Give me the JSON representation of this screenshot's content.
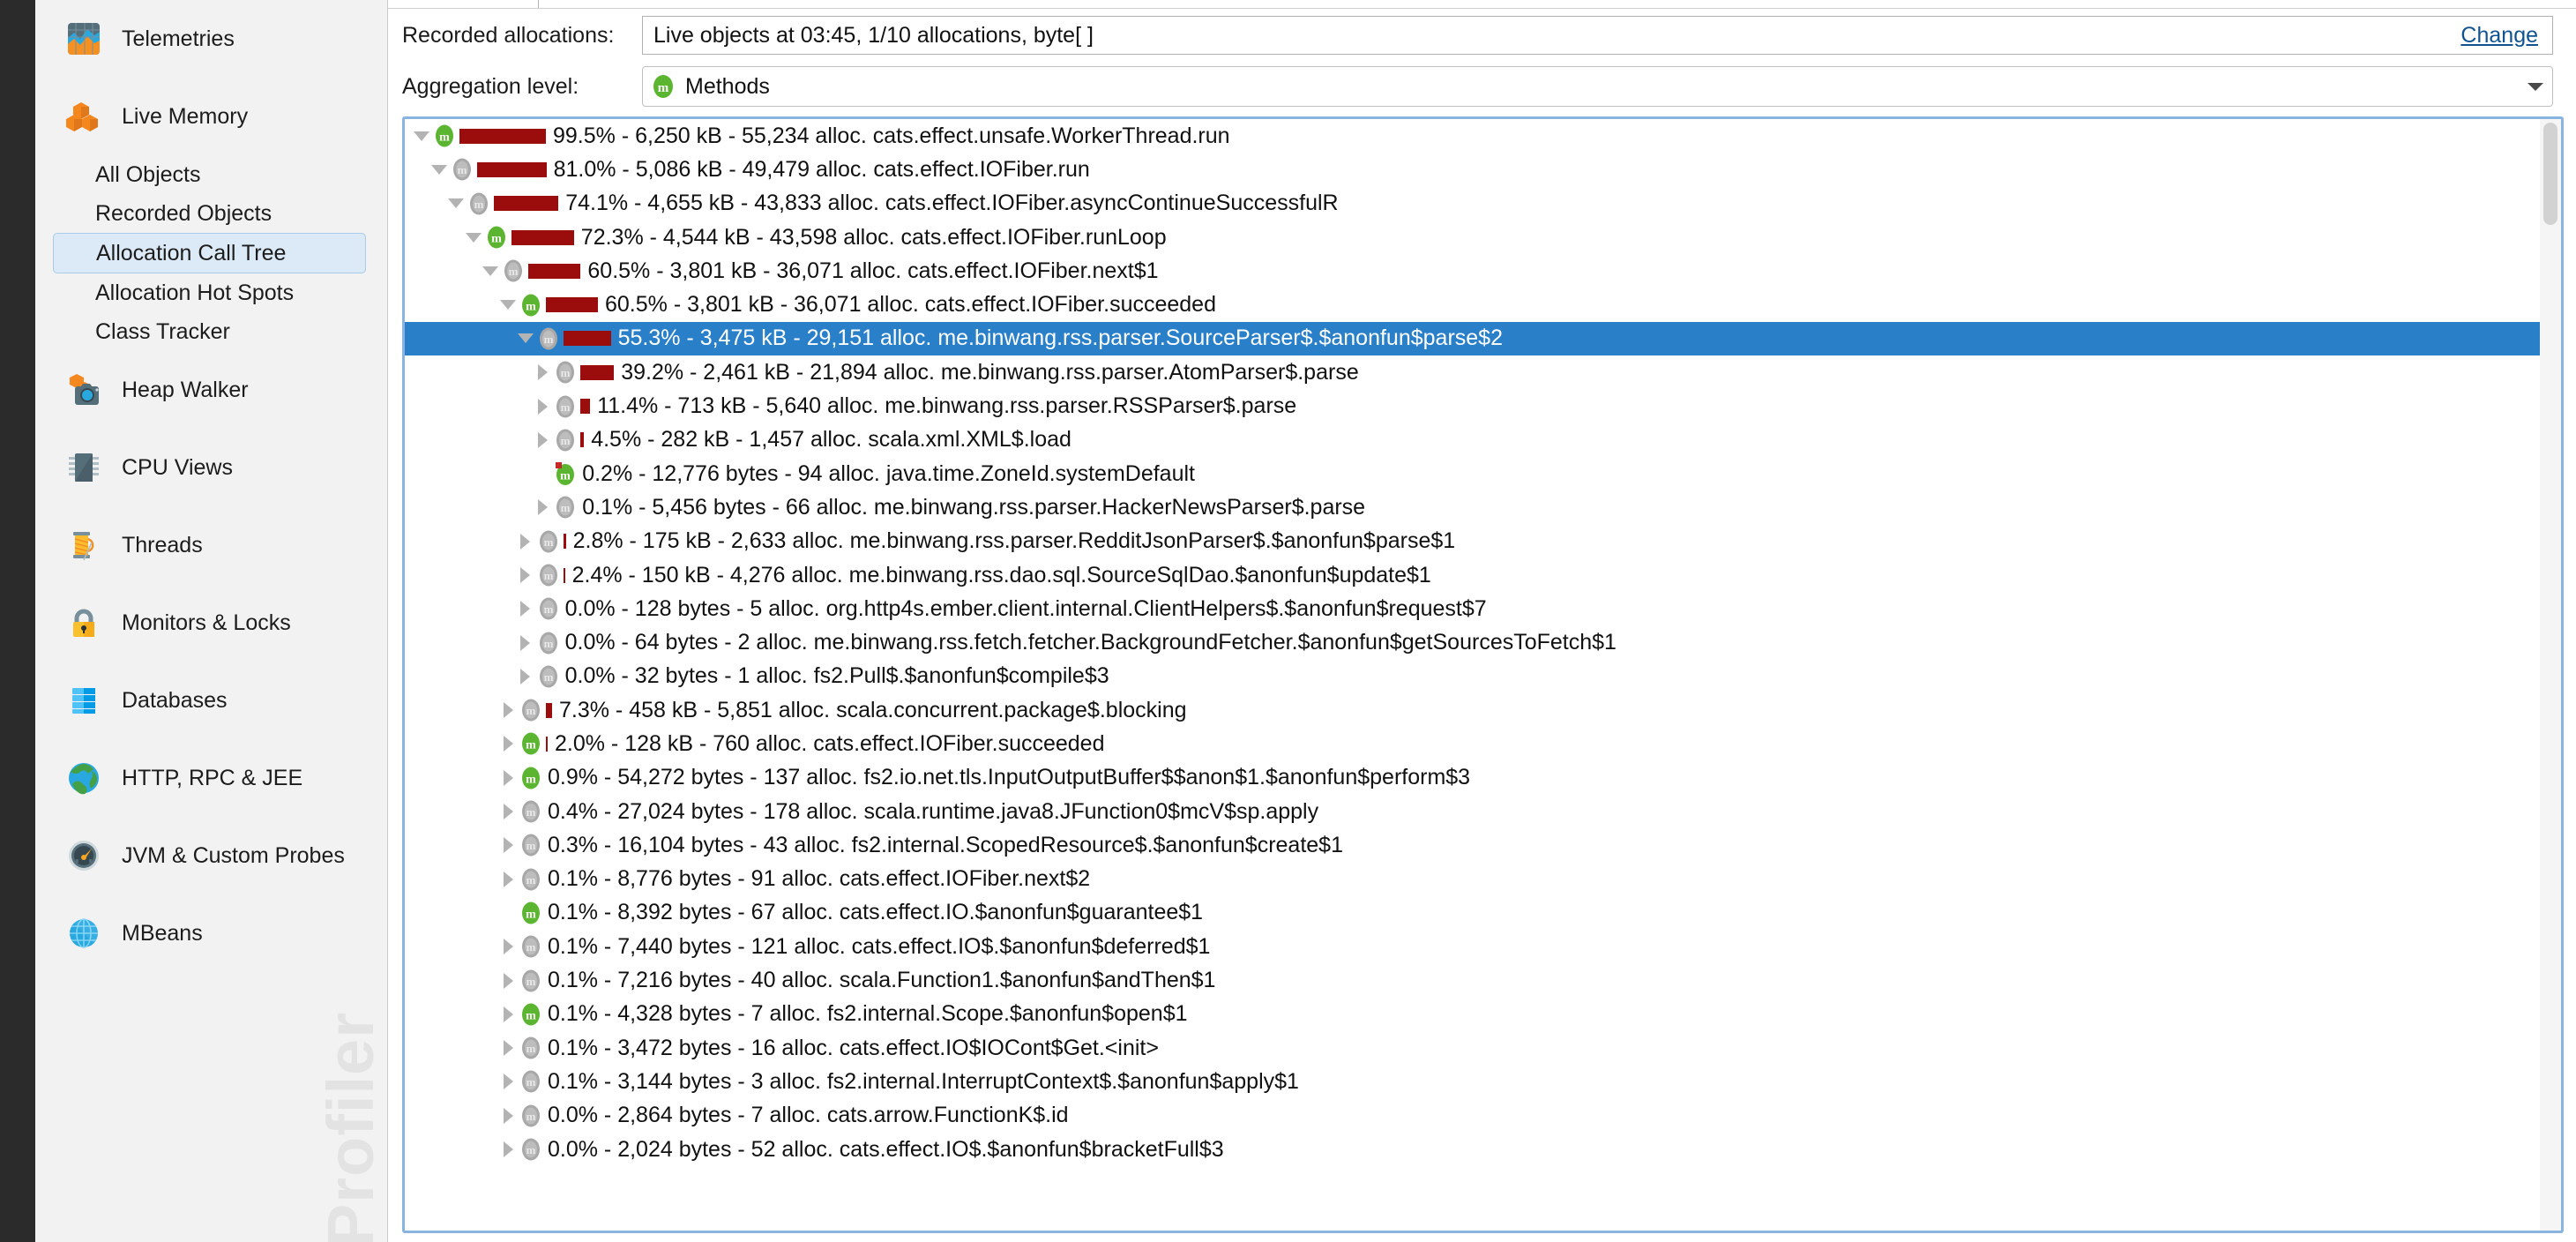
{
  "sidebar": {
    "items": [
      {
        "label": "Telemetries",
        "icon": "telemetries-icon",
        "kind": "top",
        "selected": false
      },
      {
        "label": "Live Memory",
        "icon": "live-memory-icon",
        "kind": "top",
        "selected": false
      },
      {
        "label": "All Objects",
        "icon": "none",
        "kind": "sub",
        "selected": false
      },
      {
        "label": "Recorded Objects",
        "icon": "none",
        "kind": "sub",
        "selected": false
      },
      {
        "label": "Allocation Call Tree",
        "icon": "none",
        "kind": "sub",
        "selected": true
      },
      {
        "label": "Allocation Hot Spots",
        "icon": "none",
        "kind": "sub",
        "selected": false
      },
      {
        "label": "Class Tracker",
        "icon": "none",
        "kind": "sub",
        "selected": false
      },
      {
        "label": "Heap Walker",
        "icon": "heap-walker-icon",
        "kind": "top",
        "selected": false
      },
      {
        "label": "CPU Views",
        "icon": "cpu-views-icon",
        "kind": "top",
        "selected": false
      },
      {
        "label": "Threads",
        "icon": "threads-icon",
        "kind": "top",
        "selected": false
      },
      {
        "label": "Monitors & Locks",
        "icon": "monitors-locks-icon",
        "kind": "top",
        "selected": false
      },
      {
        "label": "Databases",
        "icon": "databases-icon",
        "kind": "top",
        "selected": false
      },
      {
        "label": "HTTP, RPC & JEE",
        "icon": "http-rpc-jee-icon",
        "kind": "top",
        "selected": false
      },
      {
        "label": "JVM & Custom Probes",
        "icon": "jvm-probes-icon",
        "kind": "top",
        "selected": false
      },
      {
        "label": "MBeans",
        "icon": "mbeans-icon",
        "kind": "top",
        "selected": false
      }
    ],
    "watermark": "Profiler"
  },
  "toolbar": {
    "recorded_label": "Recorded allocations:",
    "recorded_value": "Live objects at 03:45, 1/10 allocations, byte[ ]",
    "change_label": "Change",
    "aggregation_label": "Aggregation level:",
    "aggregation_value": "Methods",
    "aggregation_icon": "method-icon-green"
  },
  "colors": {
    "bar": "#9b0d0d",
    "selection": "#2a7fc9",
    "link": "#10538f",
    "method_green": "#5cb531",
    "method_gray": "#a0a0a0"
  },
  "tree": {
    "rows": [
      {
        "depth": 0,
        "twisty": "open",
        "icon": "green",
        "pct": "99.5%",
        "size": "6,250 kB",
        "allocs": "55,234",
        "method": "cats.effect.unsafe.WorkerThread.run",
        "text": "99.5% - 6,250 kB - 55,234 alloc. cats.effect.unsafe.WorkerThread.run",
        "bar": 99.5,
        "selected": false
      },
      {
        "depth": 1,
        "twisty": "open",
        "icon": "gray",
        "pct": "81.0%",
        "size": "5,086 kB",
        "allocs": "49,479",
        "method": "cats.effect.IOFiber.run",
        "text": "81.0% - 5,086 kB - 49,479 alloc. cats.effect.IOFiber.run",
        "bar": 81.0,
        "selected": false
      },
      {
        "depth": 2,
        "twisty": "open",
        "icon": "gray",
        "pct": "74.1%",
        "size": "4,655 kB",
        "allocs": "43,833",
        "method": "cats.effect.IOFiber.asyncContinueSuccessfulR",
        "text": "74.1% - 4,655 kB - 43,833 alloc. cats.effect.IOFiber.asyncContinueSuccessfulR",
        "bar": 74.1,
        "selected": false
      },
      {
        "depth": 3,
        "twisty": "open",
        "icon": "green",
        "pct": "72.3%",
        "size": "4,544 kB",
        "allocs": "43,598",
        "method": "cats.effect.IOFiber.runLoop",
        "text": "72.3% - 4,544 kB - 43,598 alloc. cats.effect.IOFiber.runLoop",
        "bar": 72.3,
        "selected": false
      },
      {
        "depth": 4,
        "twisty": "open",
        "icon": "gray",
        "pct": "60.5%",
        "size": "3,801 kB",
        "allocs": "36,071",
        "method": "cats.effect.IOFiber.next$1",
        "text": "60.5% - 3,801 kB - 36,071 alloc. cats.effect.IOFiber.next$1",
        "bar": 60.5,
        "selected": false
      },
      {
        "depth": 5,
        "twisty": "open",
        "icon": "green",
        "pct": "60.5%",
        "size": "3,801 kB",
        "allocs": "36,071",
        "method": "cats.effect.IOFiber.succeeded",
        "text": "60.5% - 3,801 kB - 36,071 alloc. cats.effect.IOFiber.succeeded",
        "bar": 60.5,
        "selected": false
      },
      {
        "depth": 6,
        "twisty": "open",
        "icon": "gray",
        "pct": "55.3%",
        "size": "3,475 kB",
        "allocs": "29,151",
        "method": "me.binwang.rss.parser.SourceParser$.$anonfun$parse$2",
        "text": "55.3% - 3,475 kB - 29,151 alloc. me.binwang.rss.parser.SourceParser$.$anonfun$parse$2",
        "bar": 55.3,
        "selected": true
      },
      {
        "depth": 7,
        "twisty": "closed",
        "icon": "gray",
        "pct": "39.2%",
        "size": "2,461 kB",
        "allocs": "21,894",
        "method": "me.binwang.rss.parser.AtomParser$.parse",
        "text": "39.2% - 2,461 kB - 21,894 alloc. me.binwang.rss.parser.AtomParser$.parse",
        "bar": 39.2,
        "selected": false
      },
      {
        "depth": 7,
        "twisty": "closed",
        "icon": "gray",
        "pct": "11.4%",
        "size": "713 kB",
        "allocs": "5,640",
        "method": "me.binwang.rss.parser.RSSParser$.parse",
        "text": "11.4% - 713 kB - 5,640 alloc. me.binwang.rss.parser.RSSParser$.parse",
        "bar": 11.4,
        "selected": false
      },
      {
        "depth": 7,
        "twisty": "closed",
        "icon": "gray",
        "pct": "4.5%",
        "size": "282 kB",
        "allocs": "1,457",
        "method": "scala.xml.XML$.load",
        "text": "4.5% - 282 kB - 1,457 alloc. scala.xml.XML$.load",
        "bar": 4.5,
        "selected": false
      },
      {
        "depth": 7,
        "twisty": "none",
        "icon": "green-red",
        "pct": "0.2%",
        "size": "12,776 bytes",
        "allocs": "94",
        "method": "java.time.ZoneId.systemDefault",
        "text": "0.2% - 12,776 bytes - 94 alloc. java.time.ZoneId.systemDefault",
        "bar": 0,
        "selected": false
      },
      {
        "depth": 7,
        "twisty": "closed",
        "icon": "gray",
        "pct": "0.1%",
        "size": "5,456 bytes",
        "allocs": "66",
        "method": "me.binwang.rss.parser.HackerNewsParser$.parse",
        "text": "0.1% - 5,456 bytes - 66 alloc. me.binwang.rss.parser.HackerNewsParser$.parse",
        "bar": 0,
        "selected": false
      },
      {
        "depth": 6,
        "twisty": "closed",
        "icon": "gray",
        "pct": "2.8%",
        "size": "175 kB",
        "allocs": "2,633",
        "method": "me.binwang.rss.parser.RedditJsonParser$.$anonfun$parse$1",
        "text": "2.8% - 175 kB - 2,633 alloc. me.binwang.rss.parser.RedditJsonParser$.$anonfun$parse$1",
        "bar": 2.8,
        "selected": false
      },
      {
        "depth": 6,
        "twisty": "closed",
        "icon": "gray",
        "pct": "2.4%",
        "size": "150 kB",
        "allocs": "4,276",
        "method": "me.binwang.rss.dao.sql.SourceSqlDao.$anonfun$update$1",
        "text": "2.4% - 150 kB - 4,276 alloc. me.binwang.rss.dao.sql.SourceSqlDao.$anonfun$update$1",
        "bar": 2.4,
        "selected": false
      },
      {
        "depth": 6,
        "twisty": "closed",
        "icon": "gray",
        "pct": "0.0%",
        "size": "128 bytes",
        "allocs": "5",
        "method": "org.http4s.ember.client.internal.ClientHelpers$.$anonfun$request$7",
        "text": "0.0% - 128 bytes - 5 alloc. org.http4s.ember.client.internal.ClientHelpers$.$anonfun$request$7",
        "bar": 0,
        "selected": false
      },
      {
        "depth": 6,
        "twisty": "closed",
        "icon": "gray",
        "pct": "0.0%",
        "size": "64 bytes",
        "allocs": "2",
        "method": "me.binwang.rss.fetch.fetcher.BackgroundFetcher.$anonfun$getSourcesToFetch$1",
        "text": "0.0% - 64 bytes - 2 alloc. me.binwang.rss.fetch.fetcher.BackgroundFetcher.$anonfun$getSourcesToFetch$1",
        "bar": 0,
        "selected": false
      },
      {
        "depth": 6,
        "twisty": "closed",
        "icon": "gray",
        "pct": "0.0%",
        "size": "32 bytes",
        "allocs": "1",
        "method": "fs2.Pull$.$anonfun$compile$3",
        "text": "0.0% - 32 bytes - 1 alloc. fs2.Pull$.$anonfun$compile$3",
        "bar": 0,
        "selected": false
      },
      {
        "depth": 5,
        "twisty": "closed",
        "icon": "gray",
        "pct": "7.3%",
        "size": "458 kB",
        "allocs": "5,851",
        "method": "scala.concurrent.package$.blocking",
        "text": "7.3% - 458 kB - 5,851 alloc. scala.concurrent.package$.blocking",
        "bar": 7.3,
        "selected": false
      },
      {
        "depth": 5,
        "twisty": "closed",
        "icon": "green",
        "pct": "2.0%",
        "size": "128 kB",
        "allocs": "760",
        "method": "cats.effect.IOFiber.succeeded",
        "text": "2.0% - 128 kB - 760 alloc. cats.effect.IOFiber.succeeded",
        "bar": 2.0,
        "selected": false
      },
      {
        "depth": 5,
        "twisty": "closed",
        "icon": "green",
        "pct": "0.9%",
        "size": "54,272 bytes",
        "allocs": "137",
        "method": "fs2.io.net.tls.InputOutputBuffer$$anon$1.$anonfun$perform$3",
        "text": "0.9% - 54,272 bytes - 137 alloc. fs2.io.net.tls.InputOutputBuffer$$anon$1.$anonfun$perform$3",
        "bar": 0,
        "selected": false
      },
      {
        "depth": 5,
        "twisty": "closed",
        "icon": "gray",
        "pct": "0.4%",
        "size": "27,024 bytes",
        "allocs": "178",
        "method": "scala.runtime.java8.JFunction0$mcV$sp.apply",
        "text": "0.4% - 27,024 bytes - 178 alloc. scala.runtime.java8.JFunction0$mcV$sp.apply",
        "bar": 0,
        "selected": false
      },
      {
        "depth": 5,
        "twisty": "closed",
        "icon": "gray",
        "pct": "0.3%",
        "size": "16,104 bytes",
        "allocs": "43",
        "method": "fs2.internal.ScopedResource$.$anonfun$create$1",
        "text": "0.3% - 16,104 bytes - 43 alloc. fs2.internal.ScopedResource$.$anonfun$create$1",
        "bar": 0,
        "selected": false
      },
      {
        "depth": 5,
        "twisty": "closed",
        "icon": "gray",
        "pct": "0.1%",
        "size": "8,776 bytes",
        "allocs": "91",
        "method": "cats.effect.IOFiber.next$2",
        "text": "0.1% - 8,776 bytes - 91 alloc. cats.effect.IOFiber.next$2",
        "bar": 0,
        "selected": false
      },
      {
        "depth": 5,
        "twisty": "none",
        "icon": "green",
        "pct": "0.1%",
        "size": "8,392 bytes",
        "allocs": "67",
        "method": "cats.effect.IO.$anonfun$guarantee$1",
        "text": "0.1% - 8,392 bytes - 67 alloc. cats.effect.IO.$anonfun$guarantee$1",
        "bar": 0,
        "selected": false
      },
      {
        "depth": 5,
        "twisty": "closed",
        "icon": "gray",
        "pct": "0.1%",
        "size": "7,440 bytes",
        "allocs": "121",
        "method": "cats.effect.IO$.$anonfun$deferred$1",
        "text": "0.1% - 7,440 bytes - 121 alloc. cats.effect.IO$.$anonfun$deferred$1",
        "bar": 0,
        "selected": false
      },
      {
        "depth": 5,
        "twisty": "closed",
        "icon": "gray",
        "pct": "0.1%",
        "size": "7,216 bytes",
        "allocs": "40",
        "method": "scala.Function1.$anonfun$andThen$1",
        "text": "0.1% - 7,216 bytes - 40 alloc. scala.Function1.$anonfun$andThen$1",
        "bar": 0,
        "selected": false
      },
      {
        "depth": 5,
        "twisty": "closed",
        "icon": "green",
        "pct": "0.1%",
        "size": "4,328 bytes",
        "allocs": "7",
        "method": "fs2.internal.Scope.$anonfun$open$1",
        "text": "0.1% - 4,328 bytes - 7 alloc. fs2.internal.Scope.$anonfun$open$1",
        "bar": 0,
        "selected": false
      },
      {
        "depth": 5,
        "twisty": "closed",
        "icon": "gray",
        "pct": "0.1%",
        "size": "3,472 bytes",
        "allocs": "16",
        "method": "cats.effect.IO$IOCont$Get.<init>",
        "text": "0.1% - 3,472 bytes - 16 alloc. cats.effect.IO$IOCont$Get.<init>",
        "bar": 0,
        "selected": false
      },
      {
        "depth": 5,
        "twisty": "closed",
        "icon": "gray",
        "pct": "0.1%",
        "size": "3,144 bytes",
        "allocs": "3",
        "method": "fs2.internal.InterruptContext$.$anonfun$apply$1",
        "text": "0.1% - 3,144 bytes - 3 alloc. fs2.internal.InterruptContext$.$anonfun$apply$1",
        "bar": 0,
        "selected": false
      },
      {
        "depth": 5,
        "twisty": "closed",
        "icon": "gray",
        "pct": "0.0%",
        "size": "2,864 bytes",
        "allocs": "7",
        "method": "cats.arrow.FunctionK$.id",
        "text": "0.0% - 2,864 bytes - 7 alloc. cats.arrow.FunctionK$.id",
        "bar": 0,
        "selected": false
      },
      {
        "depth": 5,
        "twisty": "closed",
        "icon": "gray",
        "pct": "0.0%",
        "size": "2,024 bytes",
        "allocs": "52",
        "method": "cats.effect.IO$.$anonfun$bracketFull$3",
        "text": "0.0% - 2,024 bytes - 52 alloc. cats.effect.IO$.$anonfun$bracketFull$3",
        "bar": 0,
        "selected": false
      }
    ]
  }
}
